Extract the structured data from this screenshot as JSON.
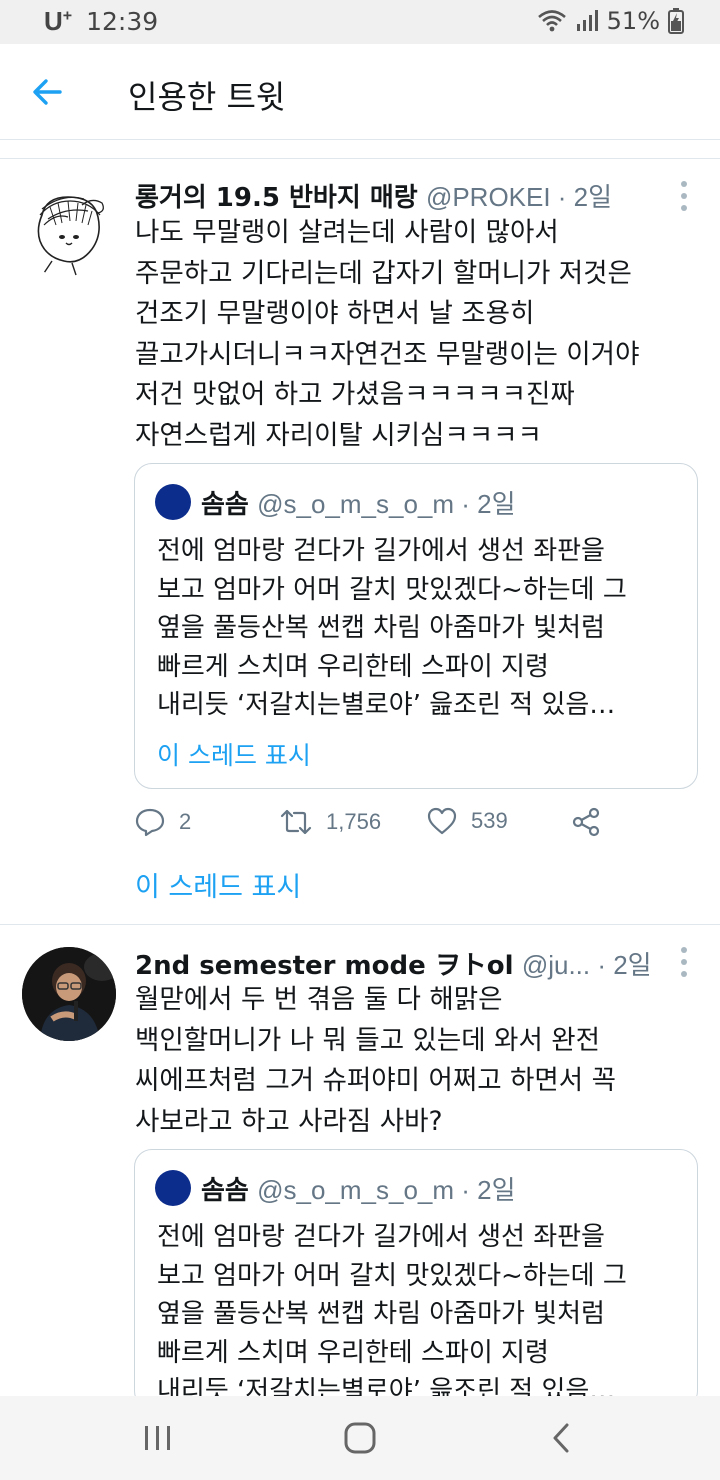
{
  "status_bar": {
    "carrier": "U",
    "carrier_sup": "+",
    "time": "12:39",
    "battery": "51%",
    "icons": [
      "wifi-icon",
      "signal-icon",
      "battery-icon"
    ]
  },
  "header": {
    "title": "인용한 트윗",
    "back_icon": "back-arrow-icon",
    "accent": "#1da1f2"
  },
  "tweets": [
    {
      "name": "롱거의 19.5 반바지 매랑",
      "handle": "@PROKEI · 2일",
      "lines": [
        "나도 무말랭이 살려는데 사람이 많아서",
        "주문하고 기다리는데 갑자기 할머니가 저것은",
        "건조기 무말랭이야 하면서 날 조용히",
        "끌고가시더니ㅋㅋ자연건조 무말랭이는 이거야",
        "저건 맛없어 하고 가셨음ㅋㅋㅋㅋㅋ진짜",
        "자연스럽게 자리이탈 시키심ㅋㅋㅋㅋ"
      ],
      "quote": {
        "name": "솜솜",
        "handle": "@s_o_m_s_o_m · 2일",
        "lines": [
          "전에 엄마랑 걷다가 길가에서 생선 좌판을",
          "보고 엄마가 어머 갈치 맛있겠다~하는데 그",
          "옆을 풀등산복 썬캡 차림 아줌마가 빛처럼",
          "빠르게 스치며 우리한테 스파이 지령",
          "내리듯 ‘저갈치는별로야’ 읊조린 적 있음…"
        ],
        "thread_label": "이 스레드 표시"
      },
      "replies": "2",
      "retweets": "1,756",
      "likes": "539",
      "thread_label": "이 스레드 표시"
    },
    {
      "name": "2nd semester mode ヲトol",
      "handle": "@ju... · 2일",
      "lines": [
        "월맏에서 두 번 겪음 둘 다 해맑은",
        "백인할머니가 나 뭐 들고 있는데 와서 완전",
        "씨에프처럼 그거 슈퍼야미 어쩌고 하면서 꼭",
        "사보라고 하고 사라짐 사바?"
      ],
      "quote": {
        "name": "솜솜",
        "handle": "@s_o_m_s_o_m · 2일",
        "lines": [
          "전에 엄마랑 걷다가 길가에서 생선 좌판을",
          "보고 엄마가 어머 갈치 맛있겠다~하는데 그",
          "옆을 풀등산복 썬캡 차림 아줌마가 빛처럼",
          "빠르게 스치며 우리한테 스파이 지령",
          "내리듯 ‘저갈치는별로야’ 읊조린 적 있음…"
        ]
      }
    }
  ],
  "nav_bar": {
    "buttons": [
      "recent-apps-icon",
      "home-icon",
      "back-icon"
    ]
  }
}
